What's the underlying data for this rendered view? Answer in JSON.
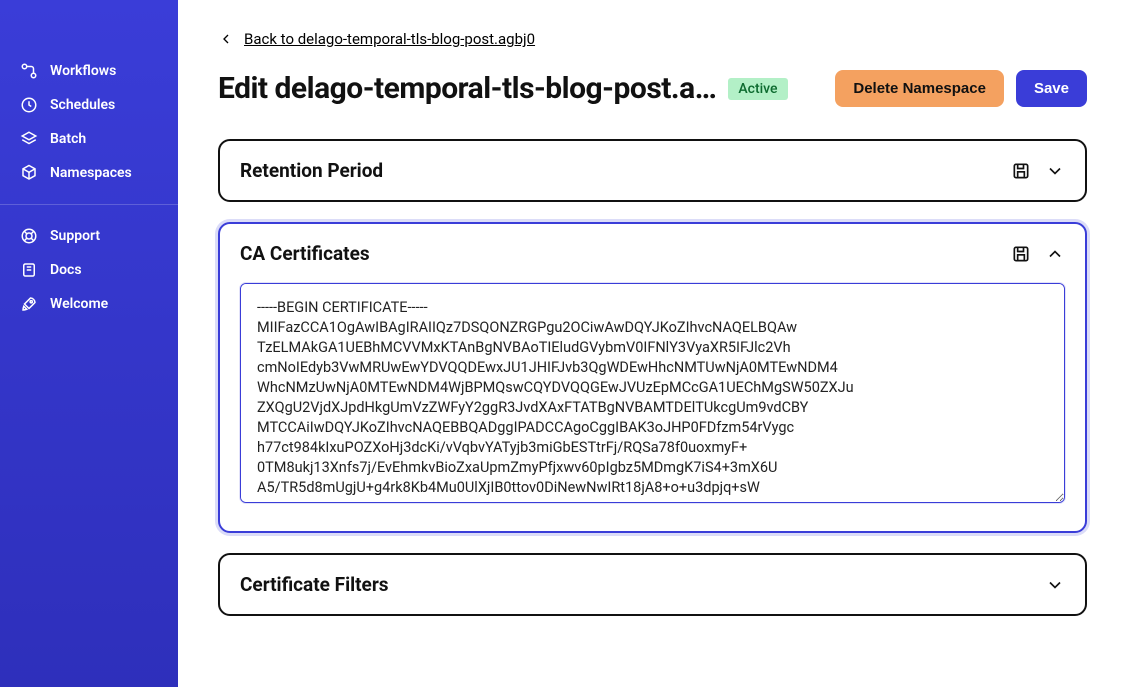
{
  "sidebar": {
    "groups": [
      {
        "items": [
          {
            "label": "Workflows",
            "icon": "flow"
          },
          {
            "label": "Schedules",
            "icon": "clock"
          },
          {
            "label": "Batch",
            "icon": "layers"
          },
          {
            "label": "Namespaces",
            "icon": "cube"
          }
        ]
      },
      {
        "items": [
          {
            "label": "Support",
            "icon": "lifebuoy"
          },
          {
            "label": "Docs",
            "icon": "book"
          },
          {
            "label": "Welcome",
            "icon": "rocket"
          }
        ]
      }
    ]
  },
  "back": {
    "label": "Back to delago-temporal-tls-blog-post.agbj0"
  },
  "header": {
    "title": "Edit delago-temporal-tls-blog-post.a…",
    "status": "Active",
    "delete_label": "Delete Namespace",
    "save_label": "Save"
  },
  "cards": {
    "retention": {
      "title": "Retention Period",
      "expanded": false,
      "has_save_icon": true
    },
    "ca_certs": {
      "title": "CA Certificates",
      "expanded": true,
      "has_save_icon": true,
      "textarea_value": "-----BEGIN CERTIFICATE-----\nMIIFazCCA1OgAwIBAgIRAIIQz7DSQONZRGPgu2OCiwAwDQYJKoZIhvcNAQELBQAw\nTzELMAkGA1UEBhMCVVMxKTAnBgNVBAoTIEludGVybmV0IFNlY3VyaXR5IFJlc2Vh\ncmNoIEdyb3VwMRUwEwYDVQQDEwxJU1JHIFJvb3QgWDEwHhcNMTUwNjA0MTEwNDM4\nWhcNMzUwNjA0MTEwNDM4WjBPMQswCQYDVQQGEwJVUzEpMCcGA1UEChMgSW50ZXJu\nZXQgU2VjdXJpdHkgUmVzZWFyY2ggR3JvdXAxFTATBgNVBAMTDElTUkcgUm9vdCBY\nMTCCAiIwDQYJKoZIhvcNAQEBBQADggIPADCCAgoCggIBAK3oJHP0FDfzm54rVygc\nh77ct984kIxuPOZXoHj3dcKi/vVqbvYATyjb3miGbESTtrFj/RQSa78f0uoxmyF+\n0TM8ukj13Xnfs7j/EvEhmkvBioZxaUpmZmyPfjxwv60pIgbz5MDmgK7iS4+3mX6U\nA5/TR5d8mUgjU+g4rk8Kb4Mu0UlXjIB0ttov0DiNewNwIRt18jA8+o+u3dpjq+sW"
    },
    "cert_filters": {
      "title": "Certificate Filters",
      "expanded": false,
      "has_save_icon": false
    }
  }
}
